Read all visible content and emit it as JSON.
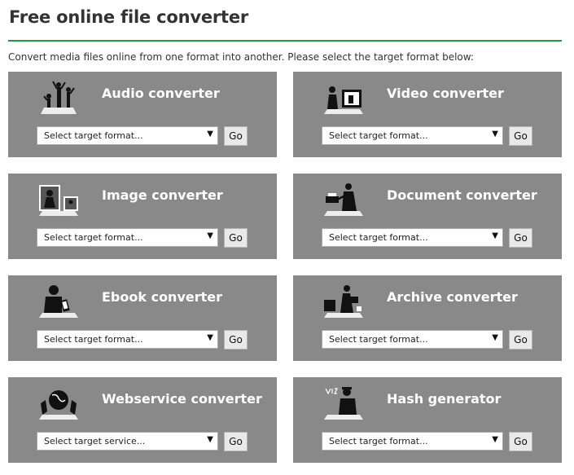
{
  "header": {
    "title": "Free online file converter",
    "intro": "Convert media files online from one format into another. Please select the target format below:",
    "accent_color": "#1f9a3e"
  },
  "card_color": "#898989",
  "go_label": "Go",
  "cards": [
    {
      "title": "Audio converter",
      "icon": "audio-dancers-icon",
      "select": "Select target format..."
    },
    {
      "title": "Video converter",
      "icon": "video-screen-icon",
      "select": "Select target format..."
    },
    {
      "title": "Image converter",
      "icon": "image-photos-icon",
      "select": "Select target format..."
    },
    {
      "title": "Document converter",
      "icon": "document-printer-icon",
      "select": "Select target format..."
    },
    {
      "title": "Ebook converter",
      "icon": "ebook-reader-icon",
      "select": "Select target format..."
    },
    {
      "title": "Archive converter",
      "icon": "archive-box-icon",
      "select": "Select target format..."
    },
    {
      "title": "Webservice converter",
      "icon": "webservice-globe-icon",
      "select": "Select target service..."
    },
    {
      "title": "Hash generator",
      "icon": "hash-generator-icon",
      "select": "Select target format..."
    }
  ]
}
